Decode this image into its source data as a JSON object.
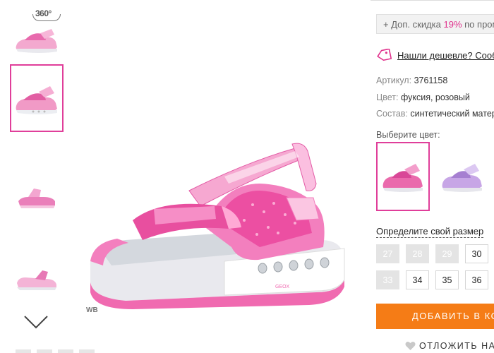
{
  "gallery": {
    "badge_360": "360°",
    "watermark": "WB",
    "scroll_down_icon": "chevron-down-icon"
  },
  "product": {
    "discount_prefix": "+ Доп. скидка ",
    "discount_percent": "19%",
    "discount_suffix": " по промо",
    "cheaper_link": "Нашли дешевле? Сообщ",
    "article_label": "Артикул:",
    "article_value": "3761158",
    "color_label": "Цвет:",
    "color_value": "фуксия, розовый",
    "material_label": "Состав:",
    "material_value": "синтетический матер",
    "choose_color_label": "Выберите цвет:",
    "colors": [
      {
        "name": "fuchsia-pink",
        "accent": "#e35ca6",
        "selected": true
      },
      {
        "name": "lilac",
        "accent": "#b48ed6",
        "selected": false
      }
    ],
    "size_title": "Определите свой размер",
    "sizes_row1": [
      {
        "label": "27",
        "available": false
      },
      {
        "label": "28",
        "available": false
      },
      {
        "label": "29",
        "available": false
      },
      {
        "label": "30",
        "available": true
      }
    ],
    "sizes_row2": [
      {
        "label": "33",
        "available": false
      },
      {
        "label": "34",
        "available": true
      },
      {
        "label": "35",
        "available": true
      },
      {
        "label": "36",
        "available": true
      }
    ],
    "add_to_cart": "ДОБАВИТЬ В КО",
    "postpone": "ОТЛОЖИТЬ НА"
  },
  "colors": {
    "accent_pink": "#e03e9a",
    "orange": "#f57c16",
    "discount_pink": "#e0318c"
  }
}
